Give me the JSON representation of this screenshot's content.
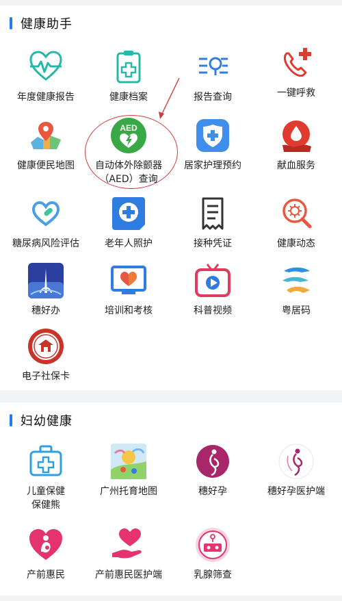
{
  "health": {
    "title": "健康助手",
    "items": [
      {
        "label": "年度健康报告",
        "icon": "heartbeat-icon"
      },
      {
        "label": "健康档案",
        "icon": "health-record-icon"
      },
      {
        "label": "报告查询",
        "icon": "report-search-icon"
      },
      {
        "label": "一键呼救",
        "icon": "emergency-call-icon"
      },
      {
        "label": "健康便民地图",
        "icon": "map-pin-icon"
      },
      {
        "label": "自动体外除颤器",
        "label2": "（AED）查询",
        "icon": "aed-icon"
      },
      {
        "label": "居家护理预约",
        "icon": "home-care-icon"
      },
      {
        "label": "献血服务",
        "icon": "blood-donation-icon"
      },
      {
        "label": "糖尿病风险评估",
        "icon": "diabetes-risk-icon"
      },
      {
        "label": "老年人照护",
        "icon": "elderly-care-icon"
      },
      {
        "label": "接种凭证",
        "icon": "vaccination-certificate-icon"
      },
      {
        "label": "健康动态",
        "icon": "health-news-icon"
      },
      {
        "label": "穗好办",
        "icon": "suihaoban-logo-icon"
      },
      {
        "label": "培训和考核",
        "icon": "training-exam-icon"
      },
      {
        "label": "科普视频",
        "icon": "tv-video-icon"
      },
      {
        "label": "粤居码",
        "icon": "yuejuma-logo-icon"
      },
      {
        "label": "电子社保卡",
        "icon": "social-security-card-icon"
      }
    ]
  },
  "maternal": {
    "title": "妇幼健康",
    "items": [
      {
        "label": "儿童保健",
        "label2": "保健熊",
        "icon": "child-care-kit-icon"
      },
      {
        "label": "广州托育地图",
        "icon": "nursery-map-icon"
      },
      {
        "label": "穗好孕",
        "icon": "pregnancy-icon"
      },
      {
        "label": "穗好孕医护端",
        "icon": "pregnancy-medical-icon"
      },
      {
        "label": "产前惠民",
        "icon": "prenatal-care-icon"
      },
      {
        "label": "产前惠民医护端",
        "icon": "prenatal-medical-icon"
      },
      {
        "label": "乳腺筛查",
        "icon": "breast-screening-icon"
      }
    ]
  },
  "aed_badge_text": "AED",
  "colors": {
    "accent": "#1f7af3",
    "highlight_circle": "#d23a3a"
  }
}
